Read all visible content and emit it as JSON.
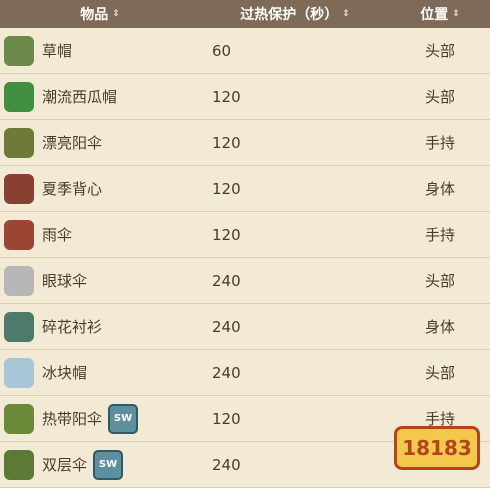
{
  "header": {
    "item_label": "物品",
    "time_label": "过热保护（秒）",
    "slot_label": "位置",
    "sort_glyph": "⇕"
  },
  "rows": [
    {
      "name": "草帽",
      "value": "60",
      "slot": "头部",
      "icon": "straw-hat-icon",
      "color": "#6b8a4a",
      "sw": false
    },
    {
      "name": "潮流西瓜帽",
      "value": "120",
      "slot": "头部",
      "icon": "watermelon-hat-icon",
      "color": "#3f8f3f",
      "sw": false
    },
    {
      "name": "漂亮阳伞",
      "value": "120",
      "slot": "手持",
      "icon": "pretty-parasol-icon",
      "color": "#6d7a3a",
      "sw": false
    },
    {
      "name": "夏季背心",
      "value": "120",
      "slot": "身体",
      "icon": "summer-vest-icon",
      "color": "#8a4030",
      "sw": false
    },
    {
      "name": "雨伞",
      "value": "120",
      "slot": "手持",
      "icon": "umbrella-icon",
      "color": "#9a4632",
      "sw": false
    },
    {
      "name": "眼球伞",
      "value": "240",
      "slot": "头部",
      "icon": "eyebrella-icon",
      "color": "#b7b7b7",
      "sw": false
    },
    {
      "name": "碎花衬衫",
      "value": "240",
      "slot": "身体",
      "icon": "floral-shirt-icon",
      "color": "#4d7a6a",
      "sw": false
    },
    {
      "name": "冰块帽",
      "value": "240",
      "slot": "头部",
      "icon": "ice-cube-hat-icon",
      "color": "#a8c6d8",
      "sw": false
    },
    {
      "name": "热带阳伞",
      "value": "120",
      "slot": "手持",
      "icon": "tropical-parasol-icon",
      "color": "#6a8a3a",
      "sw": true
    },
    {
      "name": "双层伞",
      "value": "240",
      "slot": "",
      "icon": "double-umbrella-icon",
      "color": "#5c7a36",
      "sw": true
    }
  ],
  "sw_badge": "SW",
  "watermark": "18183"
}
